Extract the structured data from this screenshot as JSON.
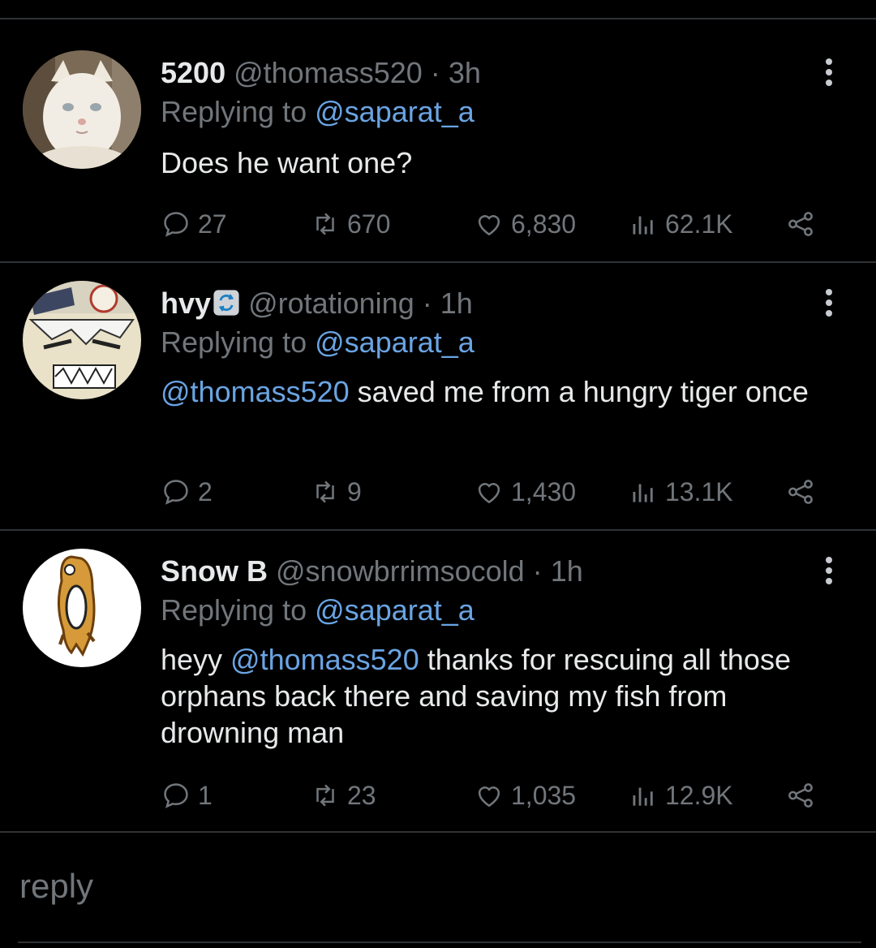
{
  "tweets": [
    {
      "name": "5200",
      "handle": "@thomass520",
      "separator": "·",
      "time": "3h",
      "replying_prefix": "Replying to",
      "replying_to": "@saparat_a",
      "text_mention": "",
      "text": "Does he want one?",
      "stats": {
        "replies": "27",
        "retweets": "670",
        "likes": "6,830",
        "views": "62.1K"
      }
    },
    {
      "name": "hvy",
      "handle": "@rotationing",
      "separator": "·",
      "time": "1h",
      "replying_prefix": "Replying to",
      "replying_to": "@saparat_a",
      "text_mention": "@thomass520",
      "text": " saved me from a hungry tiger once",
      "stats": {
        "replies": "2",
        "retweets": "9",
        "likes": "1,430",
        "views": "13.1K"
      }
    },
    {
      "name": "Snow B",
      "handle": "@snowbrrimsocold",
      "separator": "·",
      "time": "1h",
      "replying_prefix": "Replying to",
      "replying_to": "@saparat_a",
      "text_pre": "heyy ",
      "text_mention": "@thomass520",
      "text": " thanks for rescuing all those orphans back there and saving my fish from drowning man",
      "stats": {
        "replies": "1",
        "retweets": "23",
        "likes": "1,035",
        "views": "12.9K"
      }
    }
  ],
  "composer": {
    "placeholder": "reply"
  },
  "colors": {
    "background": "#000000",
    "mention": "#6aa4e3",
    "muted": "#71767b",
    "divider": "#2f3336"
  },
  "icons": [
    "comment-icon",
    "retweet-icon",
    "heart-icon",
    "views-icon",
    "share-icon",
    "more-icon",
    "rotate-badge-icon"
  ]
}
